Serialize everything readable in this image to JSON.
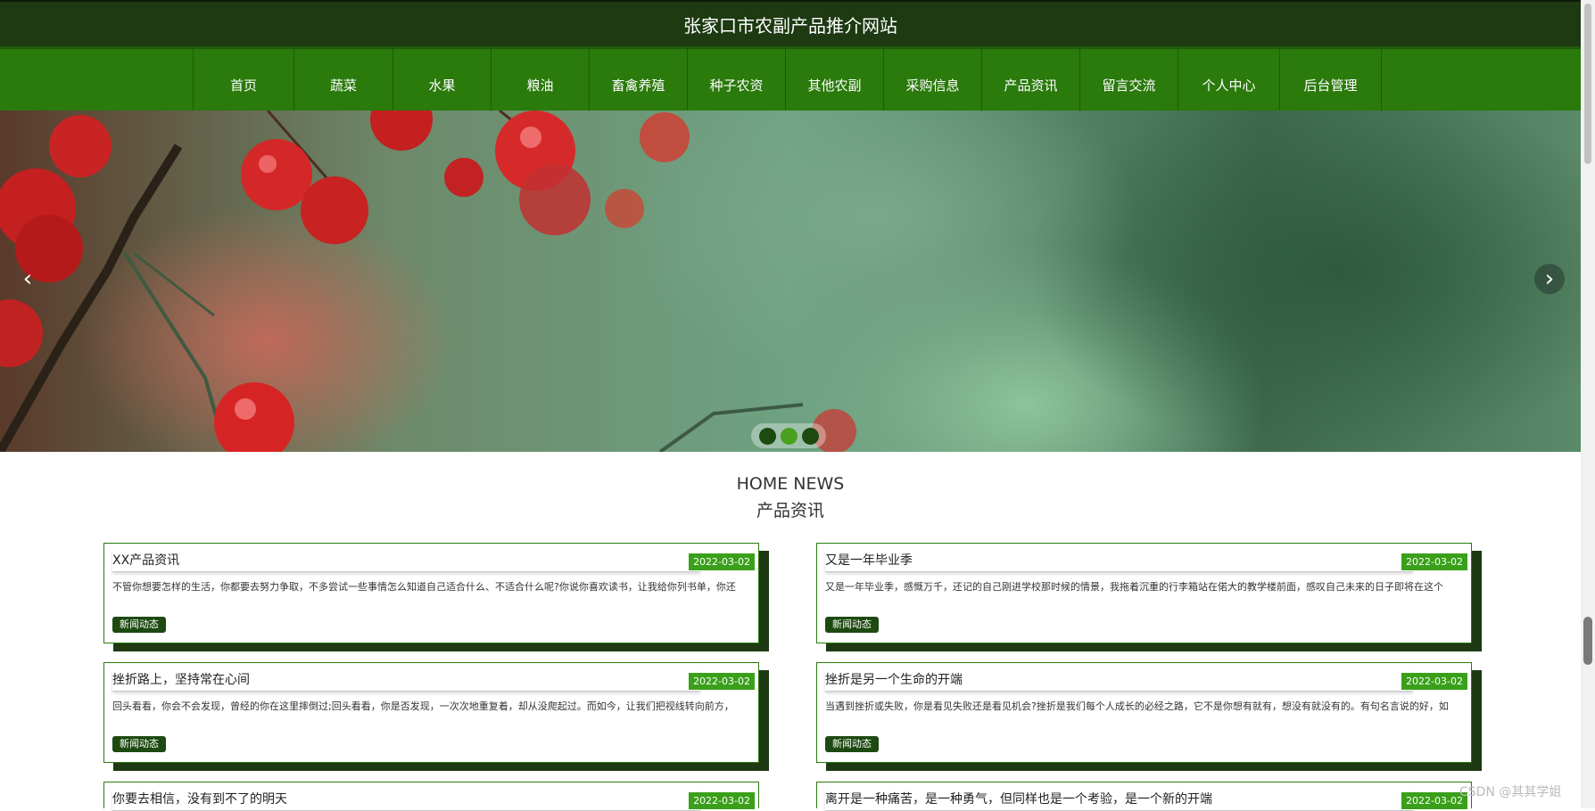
{
  "header": {
    "title": "张家口市农副产品推介网站"
  },
  "nav": {
    "items": [
      {
        "label": "首页"
      },
      {
        "label": "蔬菜"
      },
      {
        "label": "水果"
      },
      {
        "label": "粮油"
      },
      {
        "label": "畜禽养殖"
      },
      {
        "label": "种子农资"
      },
      {
        "label": "其他农副"
      },
      {
        "label": "采购信息"
      },
      {
        "label": "产品资讯"
      },
      {
        "label": "留言交流"
      },
      {
        "label": "个人中心"
      },
      {
        "label": "后台管理"
      }
    ]
  },
  "banner": {
    "prev_icon": "‹",
    "next_icon": "›",
    "dots": 3,
    "active_dot": 1
  },
  "news_section": {
    "title_en": "HOME NEWS",
    "title_cn": "产品资讯"
  },
  "news": [
    {
      "title": "XX产品资讯",
      "date": "2022-03-02",
      "desc": "不管你想要怎样的生活，你都要去努力争取，不多尝试一些事情怎么知道自己适合什么、不适合什么呢?你说你喜欢读书，让我给你列书单，你还",
      "tag": "新闻动态"
    },
    {
      "title": "又是一年毕业季",
      "date": "2022-03-02",
      "desc": "又是一年毕业季，感慨万千，还记的自己刚进学校那时候的情景，我拖着沉重的行李箱站在偌大的教学楼前面，感叹自己未来的日子即将在这个",
      "tag": "新闻动态"
    },
    {
      "title": "挫折路上，坚持常在心间",
      "date": "2022-03-02",
      "desc": "回头看看，你会不会发现，曾经的你在这里摔倒过;回头看看，你是否发现，一次次地重复着，却从没爬起过。而如今，让我们把视线转向前方，",
      "tag": "新闻动态"
    },
    {
      "title": "挫折是另一个生命的开端",
      "date": "2022-03-02",
      "desc": "当遇到挫折或失败，你是看见失败还是看见机会?挫折是我们每个人成长的必经之路，它不是你想有就有，想没有就没有的。有句名言说的好，如",
      "tag": "新闻动态"
    },
    {
      "title": "你要去相信，没有到不了的明天",
      "date": "2022-03-02",
      "desc": "",
      "tag": "新闻动态"
    },
    {
      "title": "离开是一种痛苦，是一种勇气，但同样也是一个考验，是一个新的开端",
      "date": "2022-03-02",
      "desc": "",
      "tag": "新闻动态"
    }
  ],
  "watermark": "CSDN @其其学姐",
  "colors": {
    "header_bg": "#1d3a12",
    "nav_bg": "#2a7a0c",
    "date_badge": "#3aa01a",
    "tag_bg": "#1d4a10"
  }
}
